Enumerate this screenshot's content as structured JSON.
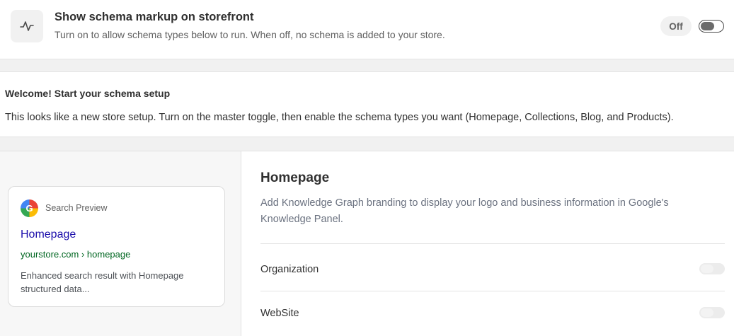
{
  "master": {
    "icon": "activity-pulse-icon",
    "title": "Show schema markup on storefront",
    "description": "Turn on to allow schema types below to run. When off, no schema is added to your store.",
    "status": "Off",
    "enabled": false
  },
  "welcome": {
    "title": "Welcome! Start your schema setup",
    "text": "This looks like a new store setup. Turn on the master toggle, then enable the schema types you want (Homepage, Collections, Blog, and Products)."
  },
  "preview": {
    "label": "Search Preview",
    "logo_letter": "G",
    "title": "Homepage",
    "url": "yourstore.com › homepage",
    "description": "Enhanced search result with Homepage structured data..."
  },
  "section": {
    "title": "Homepage",
    "description": "Add Knowledge Graph branding to display your logo and business information in Google's Knowledge Panel.",
    "rows": [
      {
        "label": "Organization",
        "enabled": false,
        "disabled": true
      },
      {
        "label": "WebSite",
        "enabled": false,
        "disabled": true
      }
    ]
  },
  "colors": {
    "link_blue": "#1a0dab",
    "url_green": "#006621",
    "text_primary": "#303030",
    "text_muted": "#616161"
  }
}
